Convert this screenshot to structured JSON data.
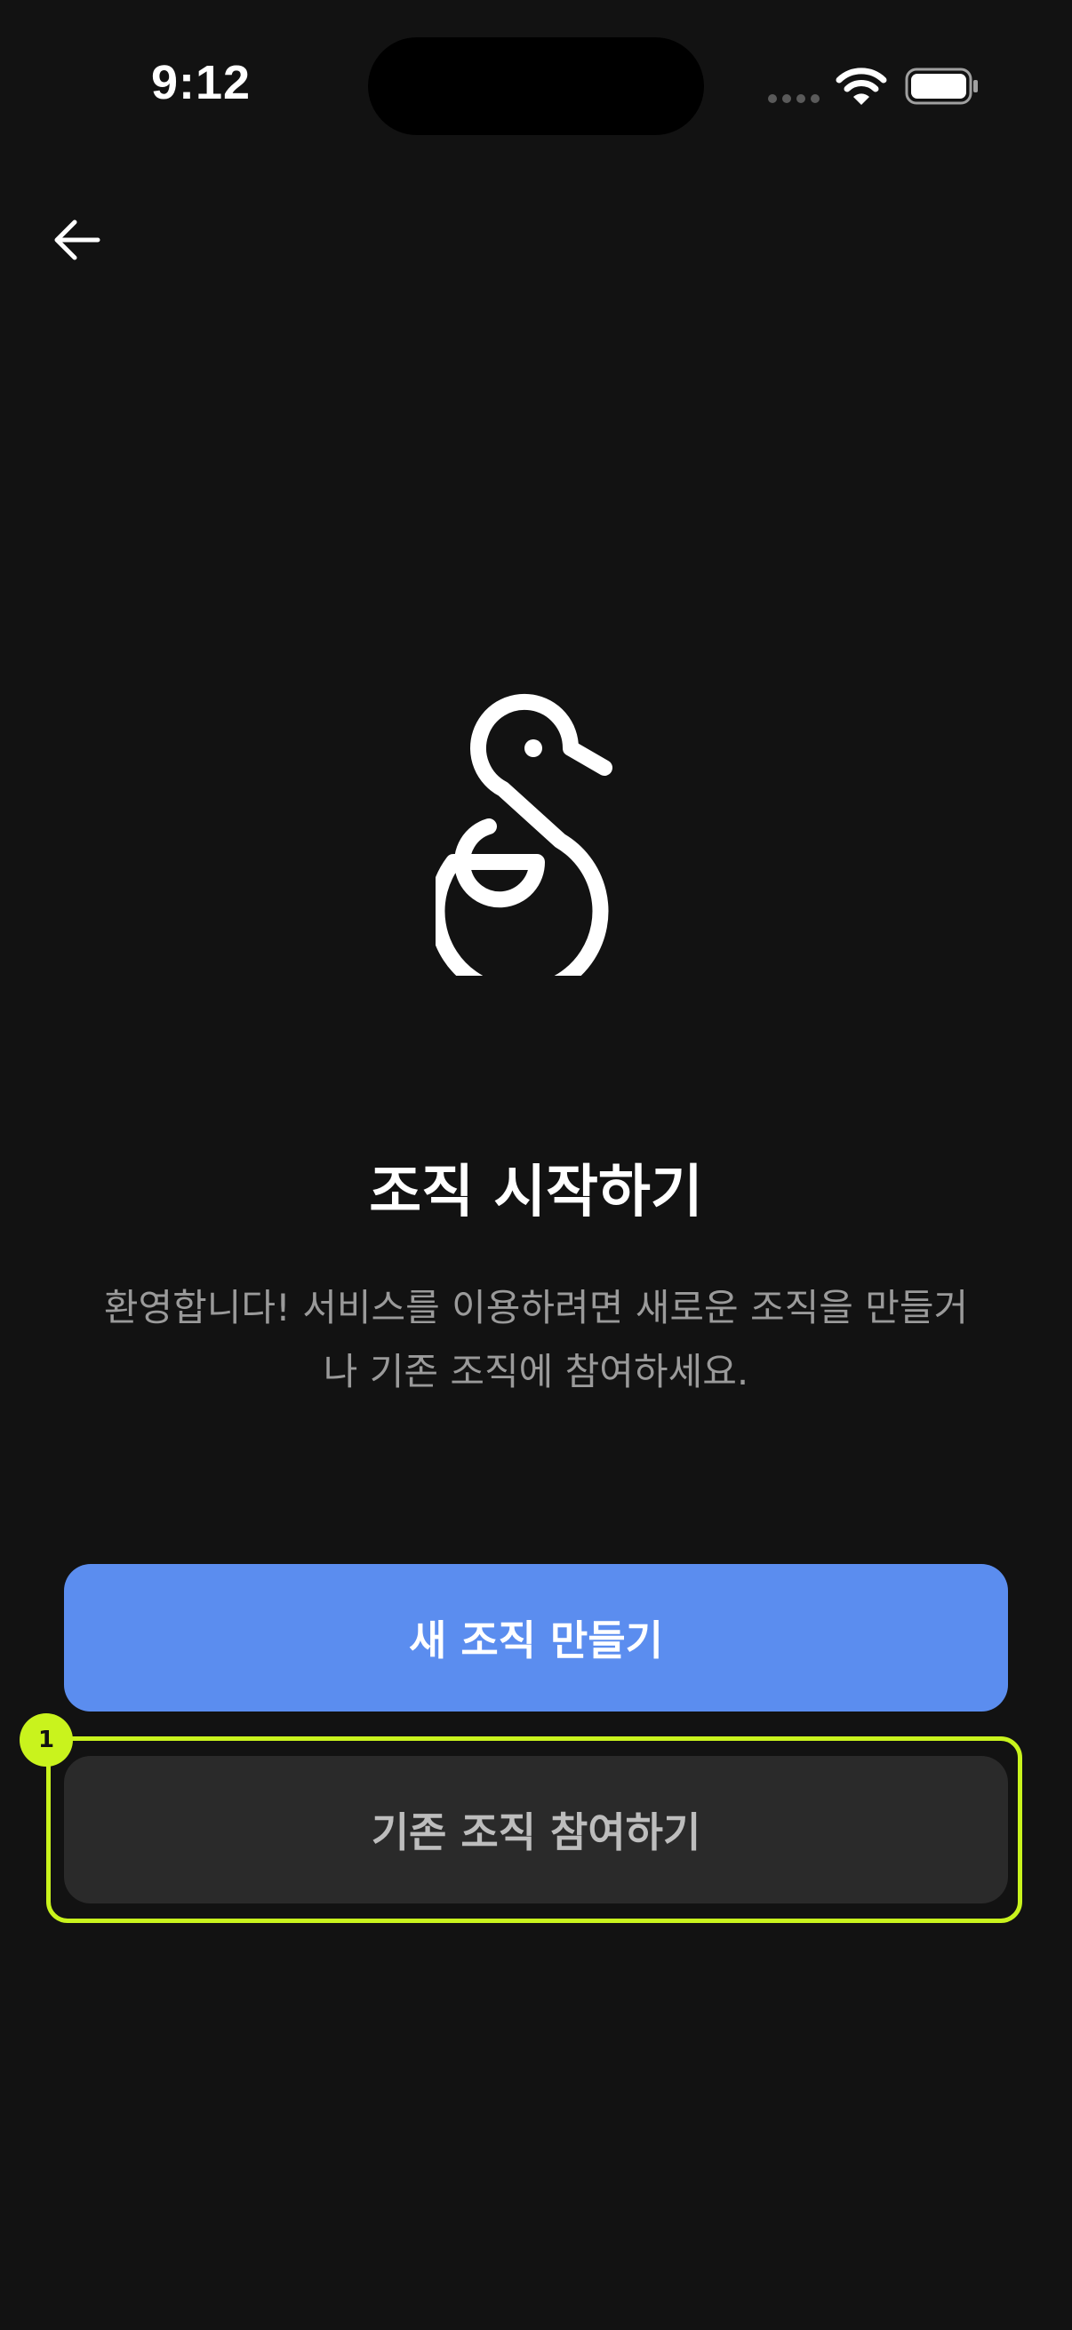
{
  "status_bar": {
    "time": "9:12"
  },
  "nav": {
    "back_icon": "arrow-left-icon"
  },
  "logo": {
    "icon": "swan-s-logo"
  },
  "content": {
    "title": "조직 시작하기",
    "subtitle_line1": "환영합니다! 서비스를 이용하려면 새로운 조직을 만들거",
    "subtitle_line2": "나 기존 조직에 참여하세요."
  },
  "actions": {
    "create_label": "새 조직 만들기",
    "join_label": "기존 조직 참여하기"
  },
  "annotation": {
    "badge": "1"
  },
  "colors": {
    "background": "#121212",
    "primary": "#5b8def",
    "secondary": "#2a2a2a",
    "highlight": "#c9f31d"
  }
}
